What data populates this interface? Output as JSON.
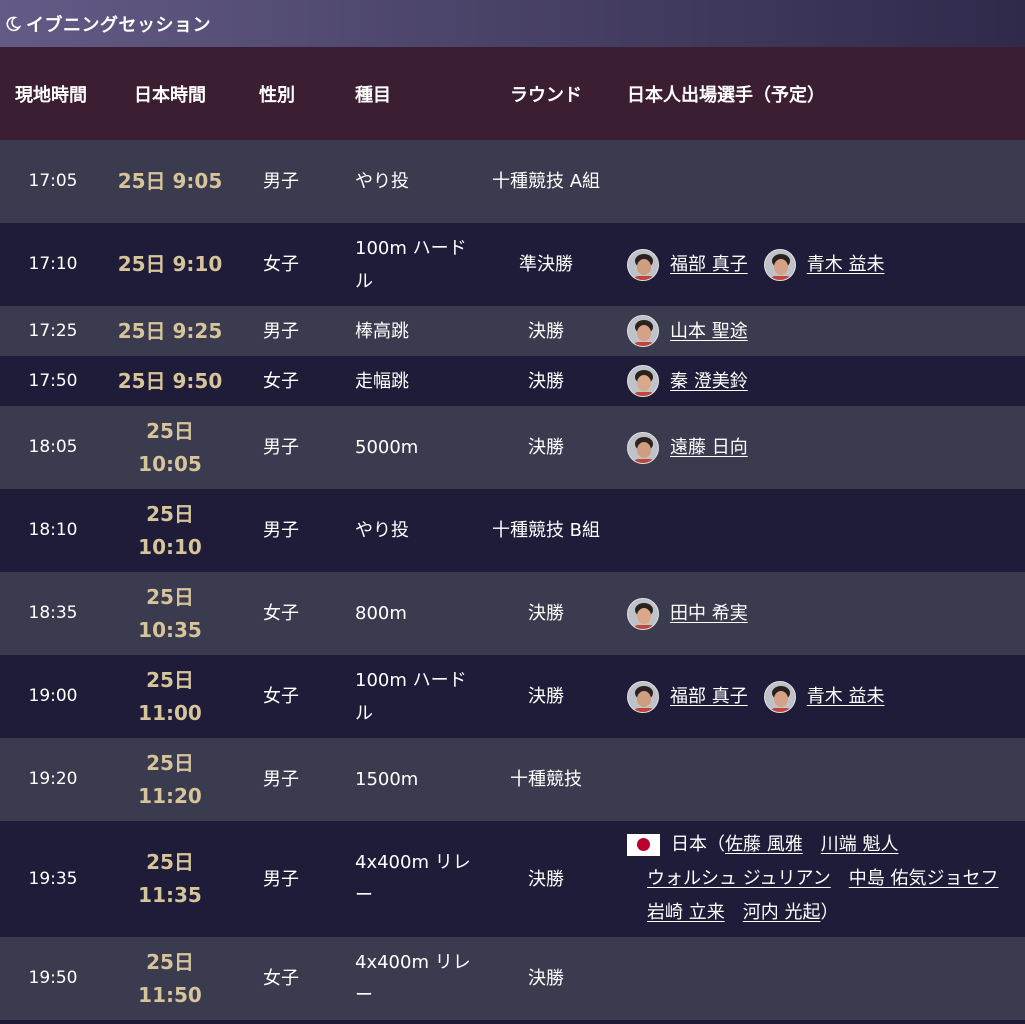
{
  "session": {
    "title": "イブニングセッション",
    "icon": "moon-icon"
  },
  "headers": {
    "local_time": "現地時間",
    "japan_time": "日本時間",
    "gender": "性別",
    "event": "種目",
    "round": "ラウンド",
    "athletes": "日本人出場選手（予定）"
  },
  "rows": [
    {
      "local": "17:05",
      "jp_day": "25日",
      "jp_time": "9:05",
      "gender": "男子",
      "event": "やり投",
      "round": "十種競技 A組"
    },
    {
      "local": "17:10",
      "jp_day": "25日",
      "jp_time": "9:10",
      "gender": "女子",
      "event": "100m ハードル",
      "round": "準決勝",
      "athletes": [
        "福部 真子",
        "青木 益未"
      ]
    },
    {
      "local": "17:25",
      "jp_day": "25日",
      "jp_time": "9:25",
      "gender": "男子",
      "event": "棒高跳",
      "round": "決勝",
      "athletes": [
        "山本 聖途"
      ]
    },
    {
      "local": "17:50",
      "jp_day": "25日",
      "jp_time": "9:50",
      "gender": "女子",
      "event": "走幅跳",
      "round": "決勝",
      "athletes": [
        "秦 澄美鈴"
      ]
    },
    {
      "local": "18:05",
      "jp_day": "25日",
      "jp_time": "10:05",
      "gender": "男子",
      "event": "5000m",
      "round": "決勝",
      "athletes": [
        "遠藤 日向"
      ]
    },
    {
      "local": "18:10",
      "jp_day": "25日",
      "jp_time": "10:10",
      "gender": "男子",
      "event": "やり投",
      "round": "十種競技 B組"
    },
    {
      "local": "18:35",
      "jp_day": "25日",
      "jp_time": "10:35",
      "gender": "女子",
      "event": "800m",
      "round": "決勝",
      "athletes": [
        "田中 希実"
      ]
    },
    {
      "local": "19:00",
      "jp_day": "25日",
      "jp_time": "11:00",
      "gender": "女子",
      "event": "100m ハードル",
      "round": "決勝",
      "athletes": [
        "福部 真子",
        "青木 益未"
      ]
    },
    {
      "local": "19:20",
      "jp_day": "25日",
      "jp_time": "11:20",
      "gender": "男子",
      "event": "1500m",
      "round": "十種競技"
    },
    {
      "local": "19:35",
      "jp_day": "25日",
      "jp_time": "11:35",
      "gender": "男子",
      "event": "4x400m リレー",
      "round": "決勝",
      "relay": {
        "team": "日本（",
        "members": [
          "佐藤 風雅",
          "川端 魁人",
          "ウォルシュ ジュリアン",
          "中島 佑気ジョセフ",
          "岩崎 立来",
          "河内 光起"
        ],
        "close": "）"
      }
    },
    {
      "local": "19:50",
      "jp_day": "25日",
      "jp_time": "11:50",
      "gender": "女子",
      "event": "4x400m リレー",
      "round": "決勝"
    }
  ],
  "colors": {
    "header_bg": "#3c1e33",
    "row_light": "#3b3b4f",
    "row_dark": "#1e1c38",
    "jp_time": "#d6c49a",
    "flag_red": "#bc002d"
  }
}
